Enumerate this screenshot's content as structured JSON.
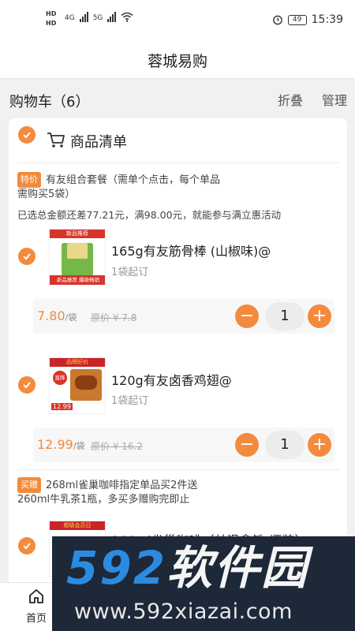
{
  "status": {
    "hd1": "HD",
    "hd2": "HD",
    "net1": "4G",
    "net2": "5G",
    "battery": "49",
    "time": "15:39"
  },
  "header": {
    "title": "蓉城易购"
  },
  "cart": {
    "title": "购物车（6）",
    "fold_label": "折叠",
    "manage_label": "管理"
  },
  "list": {
    "title": "商品清单"
  },
  "promos": [
    {
      "tag": "特价",
      "text": "有友组合套餐（需单个点击，每个单品需购买5袋）",
      "note": "已选总金额还差77.21元，满98.00元，就能参与满立惠活动"
    },
    {
      "tag": "买赠",
      "text": "268ml雀巢咖啡指定单品买2件送260ml牛乳茶1瓶，多买多赠购完即止"
    }
  ],
  "products": [
    {
      "name": "165g有友筋骨棒 (山椒味)@",
      "min_order": "1袋起订",
      "price": "7.80",
      "unit": "/袋",
      "orig_price": "原价 ¥ 7.8",
      "qty": "1",
      "thumb_banner_top": "新品推荐",
      "thumb_banner_bottom": "新品推荐 爆款畅销"
    },
    {
      "name": "120g有友卤香鸡翅@",
      "min_order": "1袋起订",
      "price": "12.99",
      "unit": "/袋",
      "orig_price": "原价 ¥ 16.2",
      "qty": "1",
      "thumb_banner_top": "品牌好价",
      "thumb_badge": "直降",
      "thumb_price": "12.99"
    },
    {
      "name": "260ml雀巢咖啡（丝滑拿铁-瓶装）@",
      "thumb_banner_top": "超级会员日"
    }
  ],
  "tabbar": {
    "home_label": "首页"
  },
  "watermark": {
    "logo_num": "592",
    "logo_cn": "软件园",
    "url": "www.592xiazai.com"
  },
  "colors": {
    "accent": "#f28b3d",
    "page_bg": "#f1f1f1",
    "watermark_bg": "#1d2838",
    "watermark_blue": "#2a8be0"
  },
  "icons": {
    "check": "check-icon",
    "cart": "cart-icon",
    "home": "home-icon",
    "alarm": "alarm-icon",
    "wifi": "wifi-icon"
  }
}
